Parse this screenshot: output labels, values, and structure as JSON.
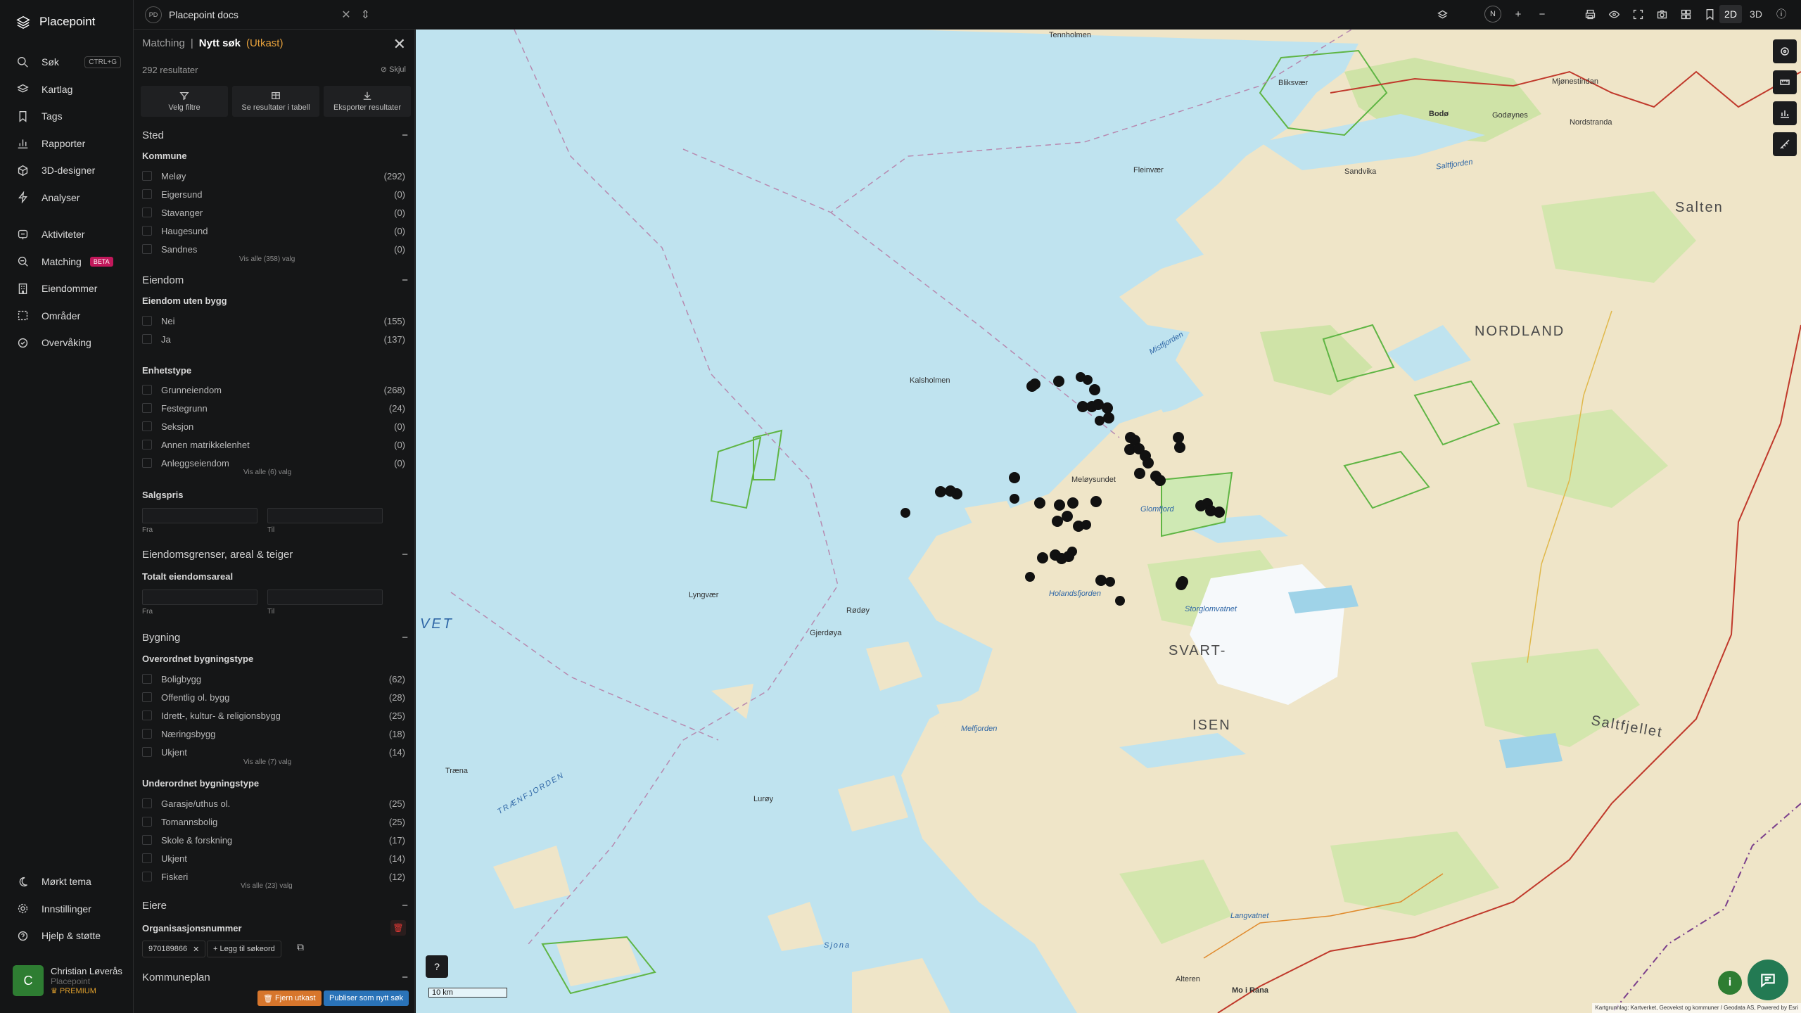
{
  "app": {
    "name": "Placepoint"
  },
  "nav": {
    "top": [
      {
        "label": "Søk",
        "icon": "search-icon",
        "shortcut": "CTRL+G"
      },
      {
        "label": "Kartlag",
        "icon": "layers-icon"
      },
      {
        "label": "Tags",
        "icon": "bookmark-icon"
      },
      {
        "label": "Rapporter",
        "icon": "bar-chart-icon"
      },
      {
        "label": "3D-designer",
        "icon": "cube-icon"
      },
      {
        "label": "Analyser",
        "icon": "lightning-icon"
      }
    ],
    "middle": [
      {
        "label": "Aktiviteter",
        "icon": "activity-icon"
      },
      {
        "label": "Matching",
        "icon": "matching-icon",
        "badge": "BETA"
      },
      {
        "label": "Eiendommer",
        "icon": "building-icon"
      },
      {
        "label": "Områder",
        "icon": "area-icon"
      },
      {
        "label": "Overvåking",
        "icon": "monitor-icon"
      }
    ],
    "bottom": [
      {
        "label": "Mørkt tema",
        "icon": "moon-icon"
      },
      {
        "label": "Innstillinger",
        "icon": "gear-icon"
      },
      {
        "label": "Hjelp & støtte",
        "icon": "help-icon"
      }
    ],
    "user": {
      "initial": "C",
      "name": "Christian Løverås",
      "org": "Placepoint",
      "plan": "PREMIUM"
    }
  },
  "topbar": {
    "workspace_badge": "PD",
    "workspace": "Placepoint docs",
    "north": "N",
    "mode_2d": "2D",
    "mode_3d": "3D"
  },
  "panel": {
    "crumb_parent": "Matching",
    "crumb_sep": "|",
    "crumb_current": "Nytt søk",
    "crumb_status": "(Utkast)",
    "result_count": "292 resultater",
    "hide_label": "Skjul",
    "actions": [
      "Velg filtre",
      "Se resultater i tabell",
      "Eksporter resultater"
    ],
    "sections": {
      "sted": "Sted",
      "eiendom": "Eiendom",
      "grenser": "Eiendomsgrenser, areal & teiger",
      "bygning": "Bygning",
      "eiere": "Eiere",
      "kommuneplan": "Kommuneplan"
    },
    "kommune": {
      "title": "Kommune",
      "items": [
        {
          "label": "Meløy",
          "count": "(292)"
        },
        {
          "label": "Eigersund",
          "count": "(0)"
        },
        {
          "label": "Stavanger",
          "count": "(0)"
        },
        {
          "label": "Haugesund",
          "count": "(0)"
        },
        {
          "label": "Sandnes",
          "count": "(0)"
        }
      ],
      "more": "Vis alle (358) valg"
    },
    "uten_bygg": {
      "title": "Eiendom uten bygg",
      "items": [
        {
          "label": "Nei",
          "count": "(155)"
        },
        {
          "label": "Ja",
          "count": "(137)"
        }
      ]
    },
    "enhetstype": {
      "title": "Enhetstype",
      "items": [
        {
          "label": "Grunneiendom",
          "count": "(268)"
        },
        {
          "label": "Festegrunn",
          "count": "(24)"
        },
        {
          "label": "Seksjon",
          "count": "(0)"
        },
        {
          "label": "Annen matrikkelenhet",
          "count": "(0)"
        },
        {
          "label": "Anleggseiendom",
          "count": "(0)"
        }
      ],
      "more": "Vis alle (6) valg"
    },
    "salgspris": {
      "title": "Salgspris",
      "from": "Fra",
      "to": "Til"
    },
    "areal": {
      "title": "Totalt eiendomsareal",
      "from": "Fra",
      "to": "Til"
    },
    "overordnet": {
      "title": "Overordnet bygningstype",
      "items": [
        {
          "label": "Boligbygg",
          "count": "(62)"
        },
        {
          "label": "Offentlig ol. bygg",
          "count": "(28)"
        },
        {
          "label": "Idrett-, kultur- & religionsbygg",
          "count": "(25)"
        },
        {
          "label": "Næringsbygg",
          "count": "(18)"
        },
        {
          "label": "Ukjent",
          "count": "(14)"
        }
      ],
      "more": "Vis alle (7) valg"
    },
    "underordnet": {
      "title": "Underordnet bygningstype",
      "items": [
        {
          "label": "Garasje/uthus ol.",
          "count": "(25)"
        },
        {
          "label": "Tomannsbolig",
          "count": "(25)"
        },
        {
          "label": "Skole & forskning",
          "count": "(17)"
        },
        {
          "label": "Ukjent",
          "count": "(14)"
        },
        {
          "label": "Fiskeri",
          "count": "(12)"
        }
      ],
      "more": "Vis alle (23) valg"
    },
    "org": {
      "title": "Organisasjonsnummer",
      "value": "970189866",
      "add": "Legg til søkeord"
    },
    "buttons": {
      "remove": "Fjern utkast",
      "publish": "Publiser som nytt søk"
    }
  },
  "map": {
    "places": [
      {
        "label": "Tennholmen"
      },
      {
        "label": "Mjønestindan"
      },
      {
        "label": "Bodø"
      },
      {
        "label": "Godøynes"
      },
      {
        "label": "Saltfjorden"
      },
      {
        "label": "Nordstranda"
      },
      {
        "label": "Sandvika"
      },
      {
        "label": "Salten"
      },
      {
        "label": "Bliksvær"
      },
      {
        "label": "Fleinvær"
      },
      {
        "label": "Mistfjorden"
      },
      {
        "label": "Glomfjord"
      },
      {
        "label": "NORDLAND"
      },
      {
        "label": "Kalsholmen"
      },
      {
        "label": "Meløysundet"
      },
      {
        "label": "Gjerdøya"
      },
      {
        "label": "Lyngvær"
      },
      {
        "label": "Rødøy"
      },
      {
        "label": "SVART-"
      },
      {
        "label": "ISEN"
      },
      {
        "label": "Saltfjellet"
      },
      {
        "label": "Holandsfjorden"
      },
      {
        "label": "Storglomvatnet"
      },
      {
        "label": "TRÆNFJORDEN"
      },
      {
        "label": "Træna"
      },
      {
        "label": "Melfjorden"
      },
      {
        "label": "Lurøy"
      },
      {
        "label": "Mo i Rana"
      },
      {
        "label": "Alteren"
      },
      {
        "label": "Langvatnet"
      },
      {
        "label": "Sjona"
      },
      {
        "label": "VET"
      }
    ],
    "scale_label": "10 km",
    "help": "?",
    "info": "i",
    "attribution": "Kartgrunnlag: Kartverket, Geovekst og kommuner / Geodata AS, Powered by Esri",
    "accent": "#2e7d32"
  },
  "colors": {
    "draft": "#e8a23c",
    "remove": "#d7762c",
    "publish": "#2a73b8",
    "beta": "#c2185b"
  }
}
